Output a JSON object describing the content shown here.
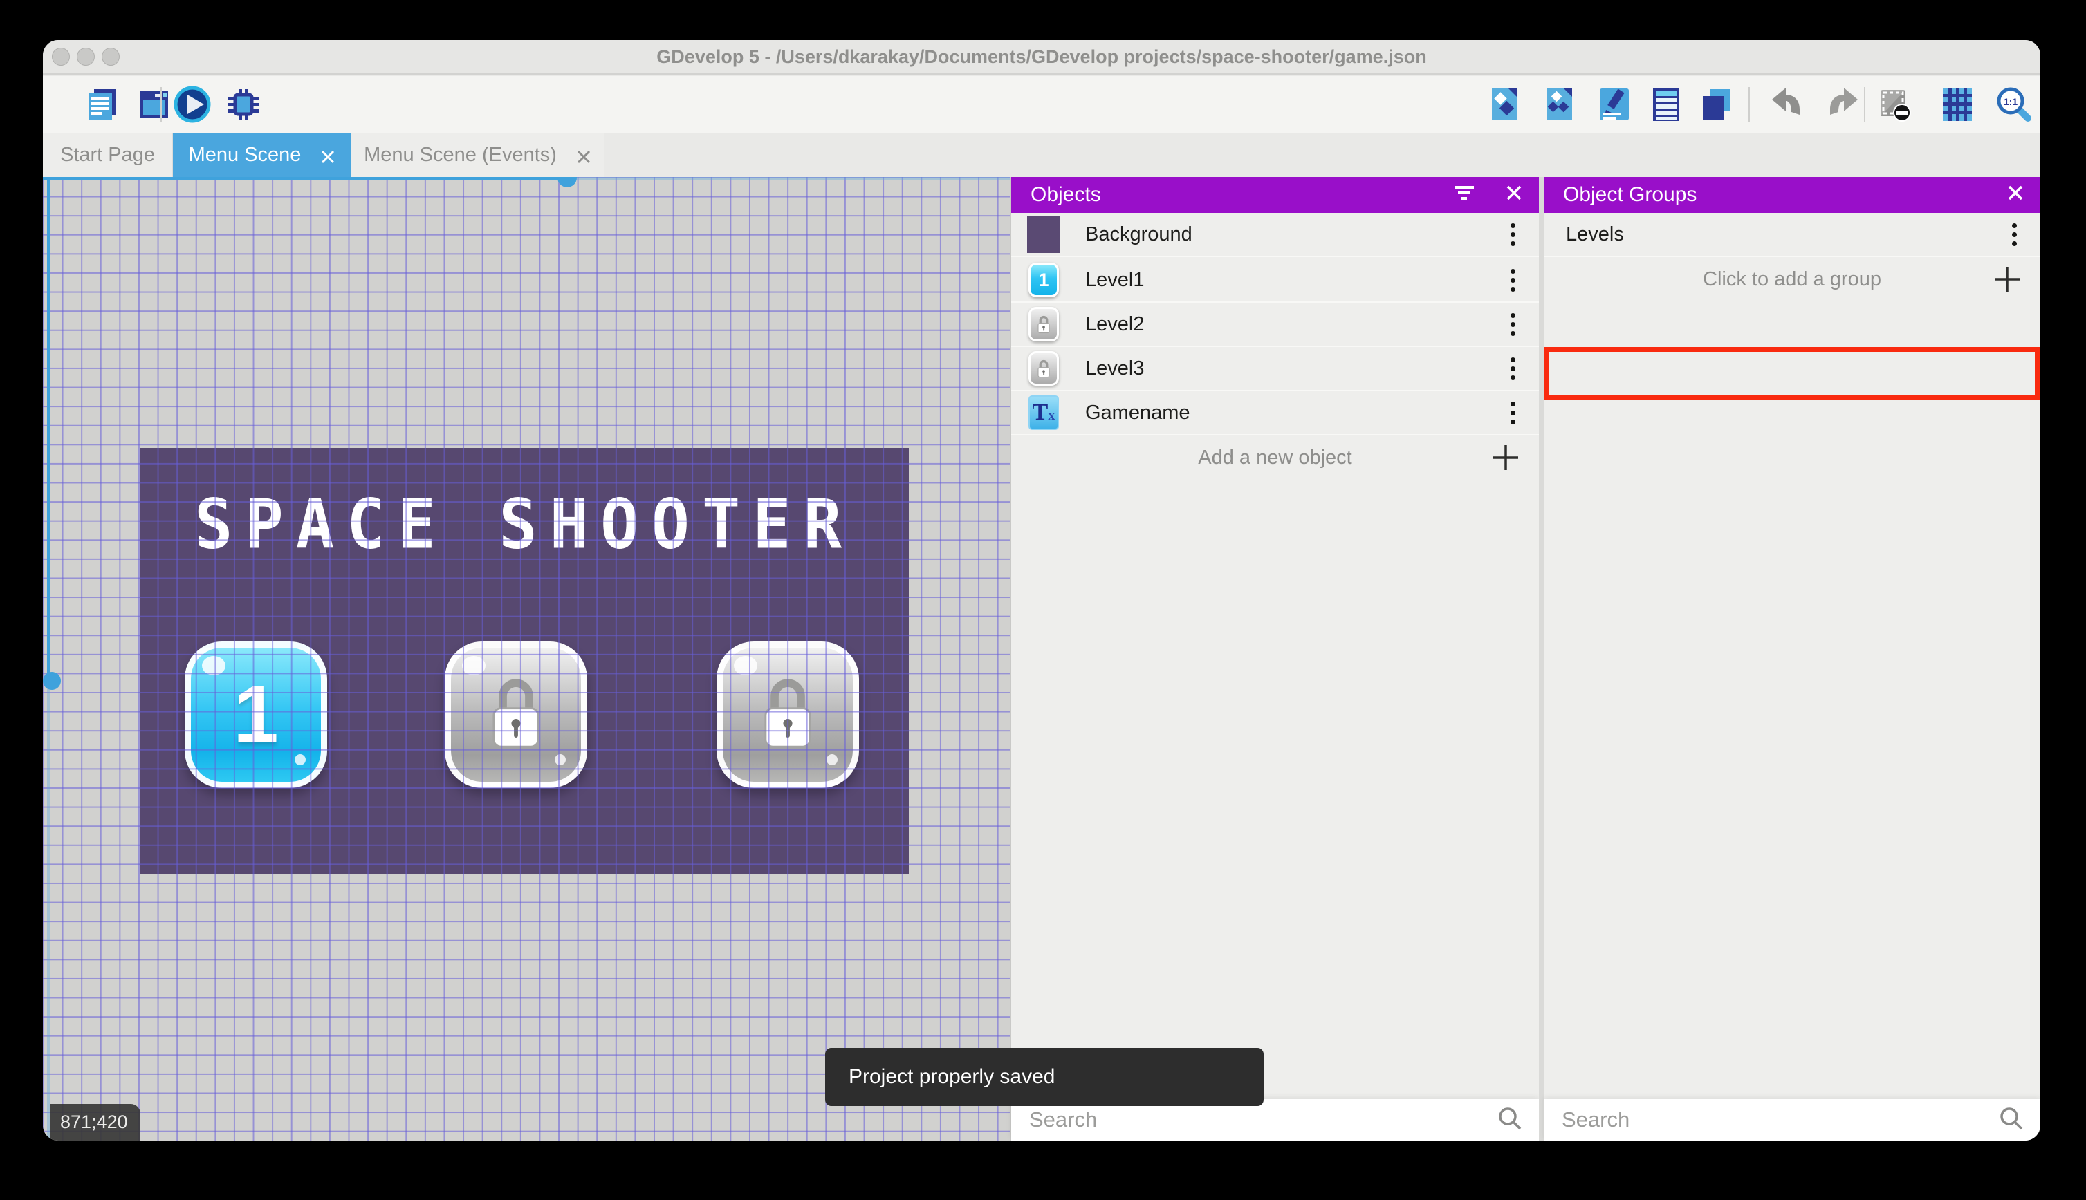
{
  "window": {
    "title": "GDevelop 5 - /Users/dkarakay/Documents/GDevelop projects/space-shooter/game.json"
  },
  "toolbar": {
    "left_icons": [
      "project-manager-icon",
      "start-page-window-icon",
      "launch-preview-icon",
      "launch-debugger-icon"
    ],
    "right_icons": [
      "objects-editor-icon",
      "object-groups-editor-icon",
      "properties-icon",
      "instances-list-icon",
      "layers-editor-icon",
      "undo-icon",
      "redo-icon",
      "edit-mask-icon",
      "toggle-grid-icon",
      "zoom-1-1-icon"
    ]
  },
  "tabs": [
    {
      "label": "Start Page",
      "active": false,
      "closable": false
    },
    {
      "label": "Menu Scene",
      "active": true,
      "closable": true
    },
    {
      "label": "Menu Scene (Events)",
      "active": false,
      "closable": true
    }
  ],
  "canvas": {
    "scene_title": "SPACE SHOOTER",
    "level_buttons": [
      {
        "label": "1",
        "state": "unlocked"
      },
      {
        "label": "",
        "state": "locked"
      },
      {
        "label": "",
        "state": "locked"
      }
    ],
    "cursor_coordinates": "871;420"
  },
  "toast": {
    "message": "Project properly saved"
  },
  "objects_panel": {
    "title": "Objects",
    "items": [
      {
        "name": "Background",
        "thumbnail": "purple-background"
      },
      {
        "name": "Level1",
        "thumbnail": "blue-1-button"
      },
      {
        "name": "Level2",
        "thumbnail": "lock-button"
      },
      {
        "name": "Level3",
        "thumbnail": "lock-button"
      },
      {
        "name": "Gamename",
        "thumbnail": "text-object"
      }
    ],
    "add_label": "Add a new object",
    "search_placeholder": "Search"
  },
  "groups_panel": {
    "title": "Object Groups",
    "items": [
      {
        "name": "Levels",
        "highlighted": true
      }
    ],
    "add_label": "Click to add a group",
    "search_placeholder": "Search"
  },
  "colors": {
    "accent_blue": "#4AA6DE",
    "header_purple": "#990FC9",
    "highlight_red": "#F92A0F",
    "scene_purple": "#574870",
    "toast_bg": "#2D2D2D",
    "grid_line": "#675ED8"
  }
}
